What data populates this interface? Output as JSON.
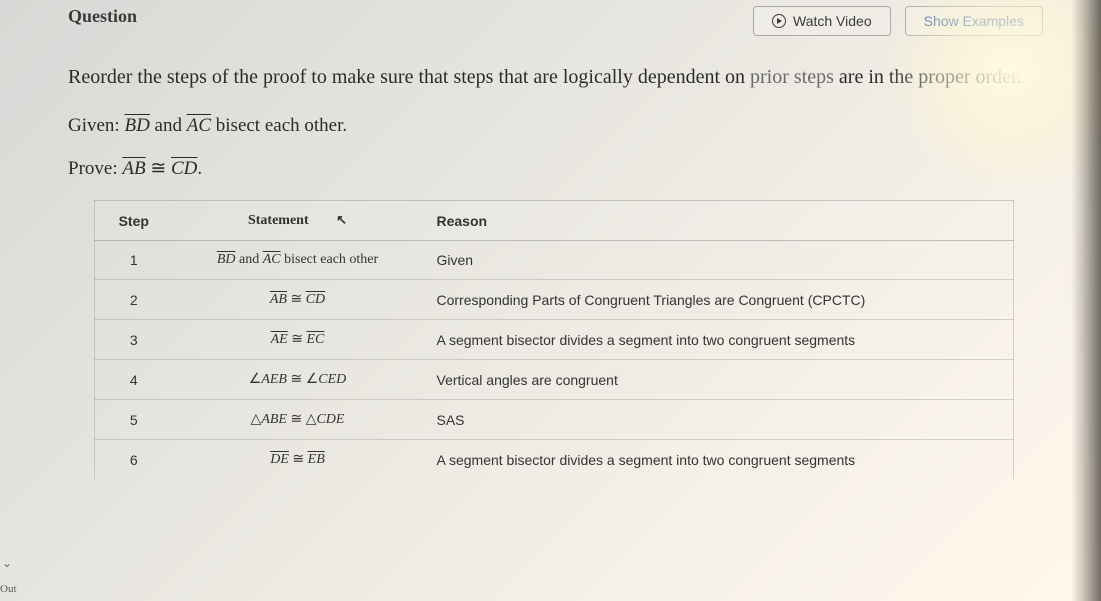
{
  "header": {
    "title": "Question",
    "watch_video": "Watch Video",
    "show_examples": "Show Examples"
  },
  "instructions": {
    "pre": "Reorder the steps of the proof to make sure that steps that are logically dependent on ",
    "grey": "prior steps",
    "post": " are in the proper order."
  },
  "given": {
    "label": "Given: ",
    "seg1": "BD",
    "mid": " and ",
    "seg2": "AC",
    "tail": " bisect each other."
  },
  "prove": {
    "label": "Prove: ",
    "seg1": "AB",
    "rel": " ≅ ",
    "seg2": "CD",
    "tail": "."
  },
  "table": {
    "headers": {
      "step": "Step",
      "statement": "Statement",
      "reason": "Reason"
    },
    "rows": [
      {
        "step": "1",
        "statement_html": "<span class='over'>BD</span> and <span class='over'>AC</span> bisect each other",
        "reason": "Given"
      },
      {
        "step": "2",
        "statement_html": "<span class='over'>AB</span> ≅ <span class='over'>CD</span>",
        "reason": "Corresponding Parts of Congruent Triangles are Congruent (CPCTC)"
      },
      {
        "step": "3",
        "statement_html": "<span class='over'>AE</span> ≅ <span class='over'>EC</span>",
        "reason": "A segment bisector divides a segment into two congruent segments"
      },
      {
        "step": "4",
        "statement_html": "∠<span class='it'>AEB</span> ≅ ∠<span class='it'>CED</span>",
        "reason": "Vertical angles are congruent"
      },
      {
        "step": "5",
        "statement_html": "△<span class='it'>ABE</span> ≅ △<span class='it'>CDE</span>",
        "reason": "SAS"
      },
      {
        "step": "6",
        "statement_html": "<span class='over'>DE</span> ≅ <span class='over'>EB</span>",
        "reason": "A segment bisector divides a segment into two congruent segments"
      }
    ]
  },
  "side": {
    "out": "Out"
  }
}
